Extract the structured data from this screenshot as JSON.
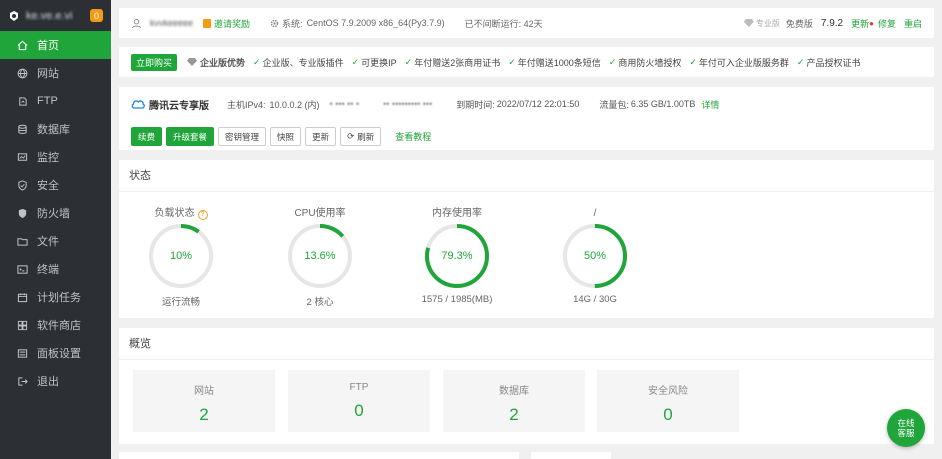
{
  "sidebar": {
    "username": "ke.ve.e.vi",
    "badge": "0",
    "items": [
      {
        "label": "首页",
        "icon": "home-icon"
      },
      {
        "label": "网站",
        "icon": "globe-icon"
      },
      {
        "label": "FTP",
        "icon": "ftp-icon"
      },
      {
        "label": "数据库",
        "icon": "database-icon"
      },
      {
        "label": "监控",
        "icon": "monitor-icon"
      },
      {
        "label": "安全",
        "icon": "shield-icon"
      },
      {
        "label": "防火墙",
        "icon": "firewall-icon"
      },
      {
        "label": "文件",
        "icon": "folder-icon"
      },
      {
        "label": "终端",
        "icon": "terminal-icon"
      },
      {
        "label": "计划任务",
        "icon": "schedule-icon"
      },
      {
        "label": "软件商店",
        "icon": "store-icon"
      },
      {
        "label": "面板设置",
        "icon": "settings-icon"
      },
      {
        "label": "退出",
        "icon": "logout-icon"
      }
    ]
  },
  "topbar": {
    "user": "kvvkeeeee",
    "invite": "邀请奖励",
    "system_label": "系统:",
    "system_value": "CentOS 7.9.2009 x86_64(Py3.7.9)",
    "uptime": "已不间断运行: 42天",
    "edition_badge": "专业版",
    "edition": "免费版",
    "version": "7.9.2",
    "update": "更新",
    "repair": "修复",
    "restart": "重启"
  },
  "promo": {
    "buy": "立即购买",
    "title": "企业版优势",
    "features": [
      "企业版、专业版插件",
      "可更换IP",
      "年付赠送2张商用证书",
      "年付赠送1000条短信",
      "商用防火墙授权",
      "年付可入企业版服务群",
      "产品授权证书"
    ]
  },
  "cloud": {
    "title": "腾讯云专享版",
    "host_label": "主机IPv4:",
    "host_value": "10.0.0.2 (内)",
    "host_ext": "• ••• •• •",
    "region": "•• ••••••••• •••",
    "expire_label": "到期时间:",
    "expire_value": "2022/07/12 22:01:50",
    "traffic_label": "流量包:",
    "traffic_value": "6.35 GB/1.00TB",
    "detail": "详情",
    "buttons": [
      "续费",
      "升级套餐",
      "密钥管理",
      "快照",
      "更新",
      "刷新"
    ],
    "tutorial": "查看教程"
  },
  "status": {
    "title": "状态",
    "gauges": [
      {
        "label": "负载状态",
        "value": "10%",
        "fraction": 0.1,
        "sub": "运行流畅",
        "help": "?"
      },
      {
        "label": "CPU使用率",
        "value": "13.6%",
        "fraction": 0.136,
        "sub": "2 核心"
      },
      {
        "label": "内存使用率",
        "value": "79.3%",
        "fraction": 0.793,
        "sub": "1575 / 1985(MB)"
      },
      {
        "label": "/",
        "value": "50%",
        "fraction": 0.5,
        "sub": "14G / 30G"
      }
    ]
  },
  "overview": {
    "title": "概览",
    "cards": [
      {
        "label": "网站",
        "value": "2"
      },
      {
        "label": "FTP",
        "value": "0"
      },
      {
        "label": "数据库",
        "value": "2"
      },
      {
        "label": "安全风险",
        "value": "0"
      }
    ]
  },
  "chat": {
    "line1": "在线",
    "line2": "客服"
  },
  "colors": {
    "accent": "#20a53a",
    "sidebar": "#2c2f34",
    "ring_track": "#e6e6e6"
  }
}
